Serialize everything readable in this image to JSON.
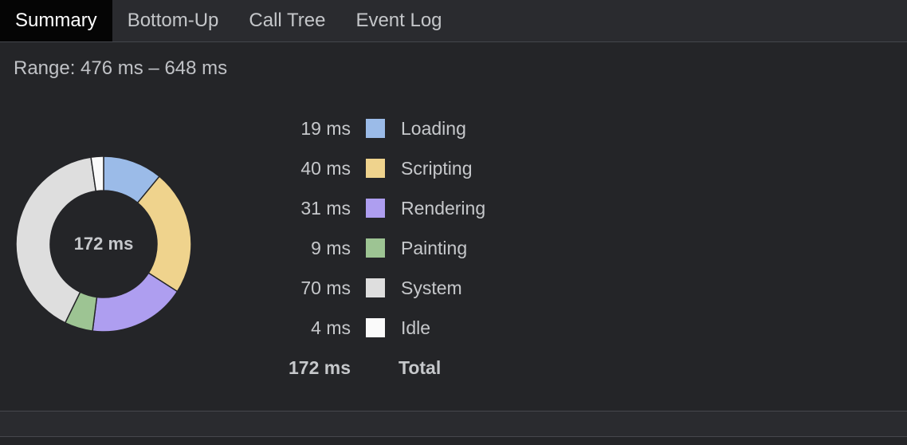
{
  "tabs": [
    {
      "label": "Summary",
      "active": true
    },
    {
      "label": "Bottom-Up",
      "active": false
    },
    {
      "label": "Call Tree",
      "active": false
    },
    {
      "label": "Event Log",
      "active": false
    }
  ],
  "range_text": "Range: 476 ms – 648 ms",
  "donut_total": "172 ms",
  "chart_data": {
    "type": "pie",
    "unit": "ms",
    "categories": [
      "Loading",
      "Scripting",
      "Rendering",
      "Painting",
      "System",
      "Idle"
    ],
    "values": [
      19,
      40,
      31,
      9,
      70,
      4
    ],
    "colors": [
      "#9bbbe8",
      "#efd38d",
      "#ae9ef0",
      "#9dc493",
      "#dedede",
      "#fafafa"
    ],
    "total": 172
  },
  "legend": [
    {
      "value": "19 ms",
      "label": "Loading",
      "color": "#9bbbe8"
    },
    {
      "value": "40 ms",
      "label": "Scripting",
      "color": "#efd38d"
    },
    {
      "value": "31 ms",
      "label": "Rendering",
      "color": "#ae9ef0"
    },
    {
      "value": "9 ms",
      "label": "Painting",
      "color": "#9dc493"
    },
    {
      "value": "70 ms",
      "label": "System",
      "color": "#dedede"
    },
    {
      "value": "4 ms",
      "label": "Idle",
      "color": "#fafafa"
    }
  ],
  "total_row": {
    "value": "172 ms",
    "label": "Total"
  }
}
